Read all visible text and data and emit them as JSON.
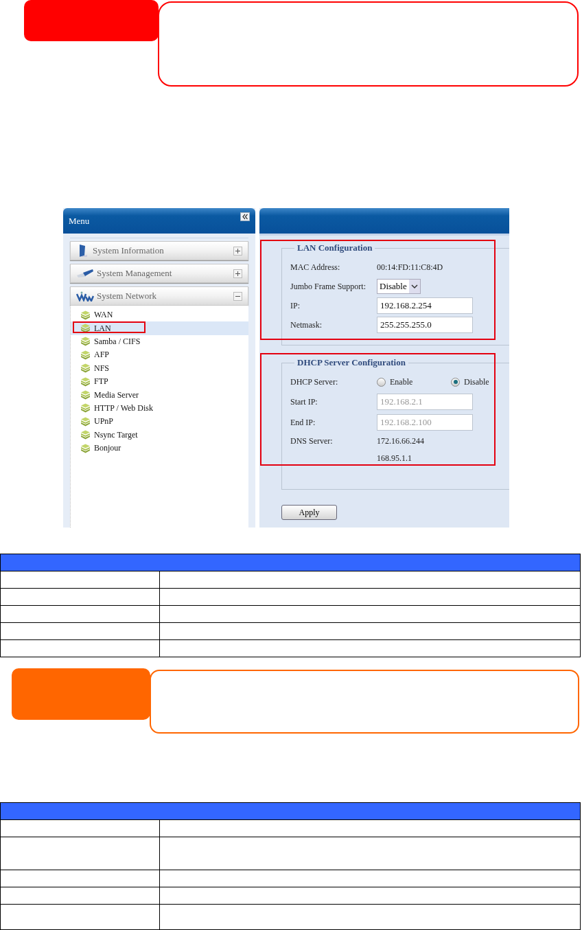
{
  "top_callout": {
    "color": "#ff0000"
  },
  "screenshot": {
    "menu_title": "Menu",
    "accordion": [
      {
        "label": "System Information",
        "expanded": false,
        "kind": "info"
      },
      {
        "label": "System Management",
        "expanded": false,
        "kind": "management"
      },
      {
        "label": "System Network",
        "expanded": true,
        "kind": "network"
      }
    ],
    "tree_items": [
      {
        "label": "WAN",
        "selected": false,
        "highlighted": false
      },
      {
        "label": "LAN",
        "selected": true,
        "highlighted": true
      },
      {
        "label": "Samba / CIFS",
        "selected": false,
        "highlighted": false
      },
      {
        "label": "AFP",
        "selected": false,
        "highlighted": false
      },
      {
        "label": "NFS",
        "selected": false,
        "highlighted": false
      },
      {
        "label": "FTP",
        "selected": false,
        "highlighted": false
      },
      {
        "label": "Media Server",
        "selected": false,
        "highlighted": false
      },
      {
        "label": "HTTP / Web Disk",
        "selected": false,
        "highlighted": false
      },
      {
        "label": "UPnP",
        "selected": false,
        "highlighted": false
      },
      {
        "label": "Nsync Target",
        "selected": false,
        "highlighted": false
      },
      {
        "label": "Bonjour",
        "selected": false,
        "highlighted": false
      }
    ],
    "sections": [
      {
        "legend": "LAN Configuration",
        "highlighted": true,
        "rows": [
          {
            "kind": "text",
            "label": "MAC Address:",
            "value": "00:14:FD:11:C8:4D"
          },
          {
            "kind": "select",
            "label": "Jumbo Frame Support:",
            "value": "Disable"
          },
          {
            "kind": "input",
            "label": "IP:",
            "value": "192.168.2.254",
            "disabled": false
          },
          {
            "kind": "input",
            "label": "Netmask:",
            "value": "255.255.255.0",
            "disabled": false
          }
        ]
      },
      {
        "legend": "DHCP Server Configuration",
        "highlighted": true,
        "rows": [
          {
            "kind": "radio",
            "label": "DHCP Server:",
            "options": [
              {
                "label": "Enable",
                "selected": false
              },
              {
                "label": "Disable",
                "selected": true
              }
            ]
          },
          {
            "kind": "input",
            "label": "Start IP:",
            "value": "192.168.2.1",
            "disabled": true
          },
          {
            "kind": "input",
            "label": "End IP:",
            "value": "192.168.2.100",
            "disabled": true
          },
          {
            "kind": "text",
            "label": "DNS Server:",
            "value": "172.16.66.244"
          },
          {
            "kind": "text",
            "value": "168.95.1.1"
          }
        ]
      }
    ],
    "apply_button": "Apply"
  },
  "table_1": {
    "rows": [
      {
        "kind": "line"
      },
      {
        "kind": "line"
      },
      {
        "kind": "line"
      },
      {
        "kind": "line"
      },
      {
        "kind": "line"
      }
    ]
  },
  "bottom_callout": {
    "color": "#ff6600"
  },
  "table_2": {
    "rows": [
      {
        "kind": "line"
      },
      {
        "kind": "double"
      },
      {
        "kind": "line"
      },
      {
        "kind": "line"
      },
      {
        "kind": "tall"
      }
    ]
  }
}
